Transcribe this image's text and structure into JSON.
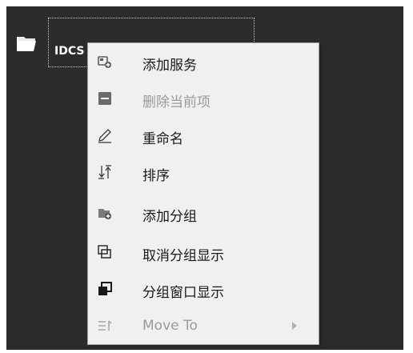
{
  "tree": {
    "node_label": "IDCS",
    "node_icon": "folder-open-icon"
  },
  "context_menu": {
    "items": [
      {
        "label": "添加服务",
        "icon": "add-service-icon",
        "enabled": true
      },
      {
        "label": "删除当前项",
        "icon": "delete-icon",
        "enabled": false
      },
      {
        "label": "重命名",
        "icon": "pencil-icon",
        "enabled": true
      },
      {
        "label": "排序",
        "icon": "sort-icon",
        "enabled": true
      },
      {
        "label": "添加分组",
        "icon": "add-group-icon",
        "enabled": true
      },
      {
        "label": "取消分组显示",
        "icon": "ungroup-icon",
        "enabled": true
      },
      {
        "label": "分组窗口显示",
        "icon": "group-window-icon",
        "enabled": true
      },
      {
        "label": "Move To",
        "icon": "move-to-icon",
        "enabled": false,
        "has_submenu": true
      }
    ]
  },
  "colors": {
    "panel_bg": "#2b2b2b",
    "menu_bg": "#f0f0f0",
    "disabled_text": "#9a9a9a"
  }
}
